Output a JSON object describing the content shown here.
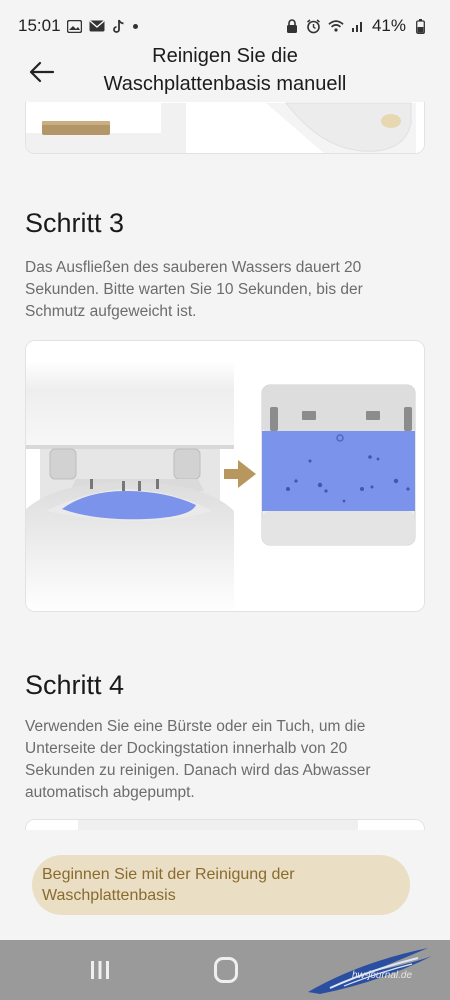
{
  "status_bar": {
    "time": "15:01",
    "battery": "41%",
    "left_icons": [
      "image-icon",
      "mail-icon",
      "tiktok-icon",
      "dot-icon"
    ],
    "right_icons": [
      "lock-icon",
      "alarm-icon",
      "wifi-icon",
      "signal-icon",
      "battery-icon"
    ]
  },
  "app_bar": {
    "title": "Reinigen Sie die Waschplattenbasis manuell",
    "back_icon": "back-arrow-icon"
  },
  "steps": [
    {
      "title": "Schritt 3",
      "description": "Das Ausfließen des sauberen Wassers dauert 20 Sekunden. Bitte warten Sie 10 Sekunden, bis der Schmutz aufgeweicht ist."
    },
    {
      "title": "Schritt 4",
      "description": "Verwenden Sie eine Bürste oder ein Tuch, um die Unterseite der Dockingstation innerhalb von 20 Sekunden zu reinigen. Danach wird das Abwasser automatisch abgepumpt."
    }
  ],
  "action": {
    "label": "Beginnen Sie mit der Reinigung der Waschplattenbasis"
  },
  "colors": {
    "accent_button_bg": "#eadfc4",
    "accent_button_text": "#8a6a2f",
    "water_blue": "#7b93ea",
    "arrow_gold": "#b8975f"
  },
  "watermark": {
    "text": "hw-journal.de"
  }
}
